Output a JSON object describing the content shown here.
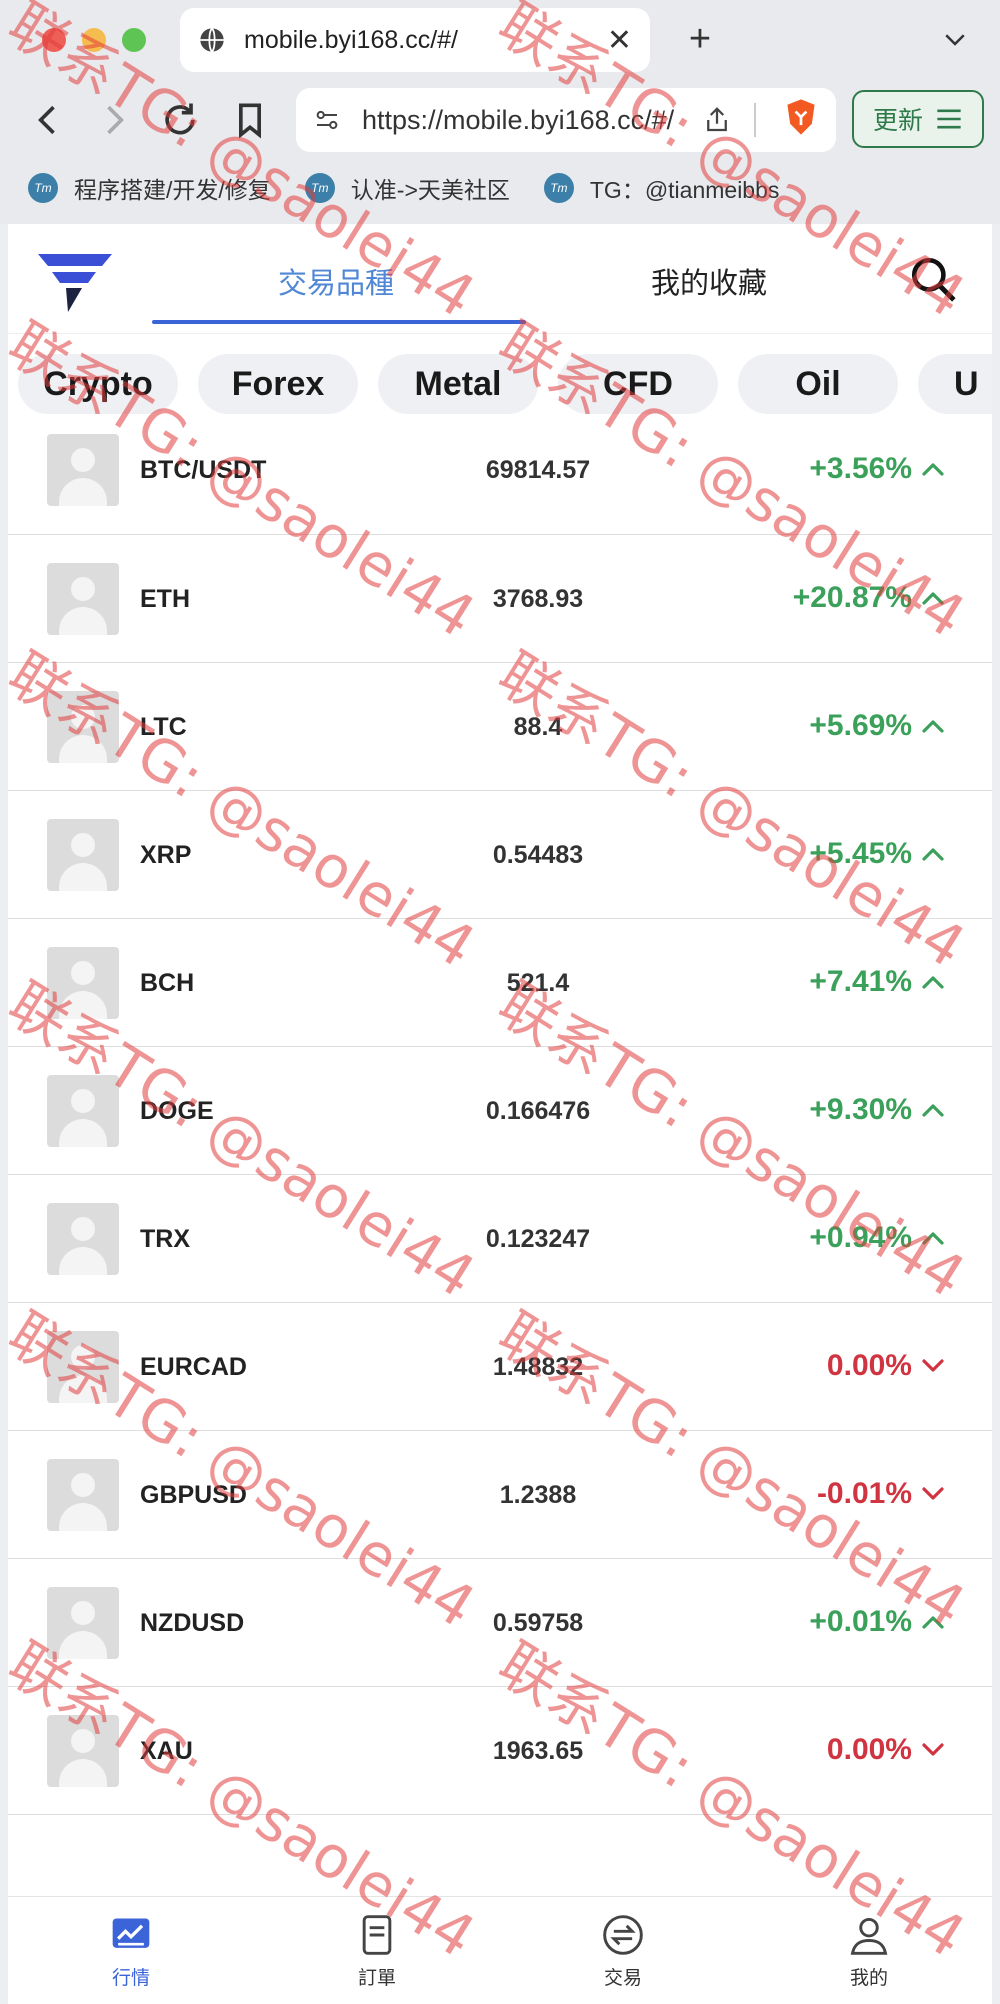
{
  "browser": {
    "tab_title": "mobile.byi168.cc/#/",
    "url": "https://mobile.byi168.cc/#/",
    "update_label": "更新",
    "bookmarks": [
      {
        "label": "程序搭建/开发/修复",
        "badge": "Tm"
      },
      {
        "label": "认准->天美社区",
        "badge": "Tm"
      },
      {
        "label": "TG：@tianmeibbs",
        "badge": "Tm"
      }
    ]
  },
  "header": {
    "tabs": [
      "交易品種",
      "我的收藏"
    ]
  },
  "categories": [
    "Crypto",
    "Forex",
    "Metal",
    "CFD",
    "Oil",
    "U"
  ],
  "markets": [
    {
      "symbol": "BTC/USDT",
      "price": "69814.57",
      "change": "+3.56%",
      "direction": "up"
    },
    {
      "symbol": "ETH",
      "price": "3768.93",
      "change": "+20.87%",
      "direction": "up"
    },
    {
      "symbol": "LTC",
      "price": "88.4",
      "change": "+5.69%",
      "direction": "up"
    },
    {
      "symbol": "XRP",
      "price": "0.54483",
      "change": "+5.45%",
      "direction": "up"
    },
    {
      "symbol": "BCH",
      "price": "521.4",
      "change": "+7.41%",
      "direction": "up"
    },
    {
      "symbol": "DOGE",
      "price": "0.166476",
      "change": "+9.30%",
      "direction": "up"
    },
    {
      "symbol": "TRX",
      "price": "0.123247",
      "change": "+0.94%",
      "direction": "up"
    },
    {
      "symbol": "EURCAD",
      "price": "1.48832",
      "change": "0.00%",
      "direction": "down"
    },
    {
      "symbol": "GBPUSD",
      "price": "1.2388",
      "change": "-0.01%",
      "direction": "down"
    },
    {
      "symbol": "NZDUSD",
      "price": "0.59758",
      "change": "+0.01%",
      "direction": "up"
    },
    {
      "symbol": "XAU",
      "price": "1963.65",
      "change": "0.00%",
      "direction": "down"
    }
  ],
  "bottom_nav": [
    "行情",
    "訂單",
    "交易",
    "我的"
  ],
  "watermark": "联系TG: @saolei44",
  "colors": {
    "accent": "#3b64d8",
    "up": "#3aa05a",
    "down": "#d03440",
    "watermark": "#e23c3c"
  }
}
